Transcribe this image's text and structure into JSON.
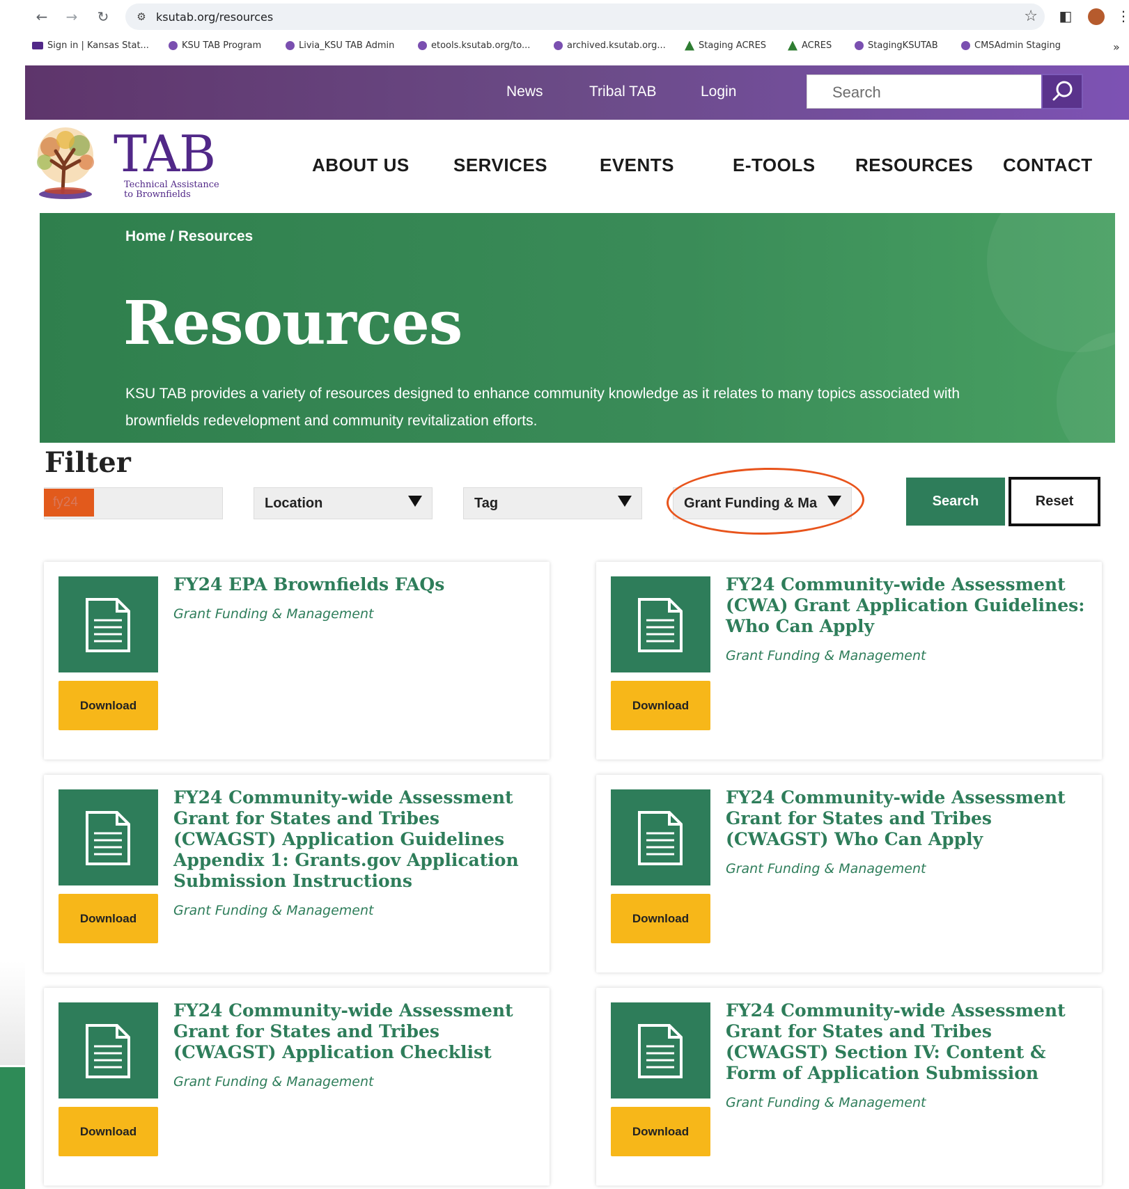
{
  "browser": {
    "url": "ksutab.org/resources",
    "bookmarks": [
      {
        "label": "Sign in | Kansas Stat...",
        "icon": "ksu"
      },
      {
        "label": "KSU TAB Program",
        "icon": "globe"
      },
      {
        "label": "Livia_KSU TAB Admin",
        "icon": "globe"
      },
      {
        "label": "etools.ksutab.org/to...",
        "icon": "globe"
      },
      {
        "label": "archived.ksutab.org...",
        "icon": "globe"
      },
      {
        "label": "Staging ACRES",
        "icon": "acres"
      },
      {
        "label": "ACRES",
        "icon": "acres"
      },
      {
        "label": "StagingKSUTAB",
        "icon": "globe"
      },
      {
        "label": "CMSAdmin Staging",
        "icon": "globe"
      }
    ],
    "overflow": "»"
  },
  "topbar": {
    "links": [
      "News",
      "Tribal TAB",
      "Login"
    ],
    "search_placeholder": "Search"
  },
  "logo": {
    "word": "TAB",
    "sub1": "Technical Assistance",
    "sub2": "to Brownfields"
  },
  "mainnav": [
    "ABOUT US",
    "SERVICES",
    "EVENTS",
    "E-TOOLS",
    "RESOURCES",
    "CONTACT"
  ],
  "hero": {
    "breadcrumb": "Home / Resources",
    "title": "Resources",
    "description": "KSU TAB provides a variety of resources designed to enhance community knowledge as it relates to many topics associated with brownfields redevelopment and community revitalization efforts."
  },
  "filter": {
    "title": "Filter",
    "keyword_value": "fy24",
    "location_label": "Location",
    "tag_label": "Tag",
    "category_label": "Grant Funding & Ma",
    "search_button": "Search",
    "reset_button": "Reset"
  },
  "colors": {
    "brand_purple": "#512888",
    "brand_green": "#2e7d5a",
    "download_yellow": "#f7b719",
    "annotation_orange": "#e8541c"
  },
  "cards": [
    {
      "title": "FY24 EPA Brownfields FAQs",
      "category": "Grant Funding & Management",
      "button": "Download"
    },
    {
      "title": "FY24 Community-wide Assessment (CWA) Grant Application Guidelines: Who Can Apply",
      "category": "Grant Funding & Management",
      "button": "Download"
    },
    {
      "title": "FY24 Community-wide Assessment Grant for States and Tribes (CWAGST) Application Guidelines Appendix 1: Grants.gov Application Submission Instructions",
      "category": "Grant Funding & Management",
      "button": "Download"
    },
    {
      "title": "FY24 Community-wide Assessment Grant for States and Tribes (CWAGST) Who Can Apply",
      "category": "Grant Funding & Management",
      "button": "Download"
    },
    {
      "title": "FY24 Community-wide Assessment Grant for States and Tribes (CWAGST) Application Checklist",
      "category": "Grant Funding & Management",
      "button": "Download"
    },
    {
      "title": "FY24 Community-wide Assessment Grant for States and Tribes (CWAGST) Section IV: Content & Form of Application Submission",
      "category": "Grant Funding & Management",
      "button": "Download"
    }
  ]
}
